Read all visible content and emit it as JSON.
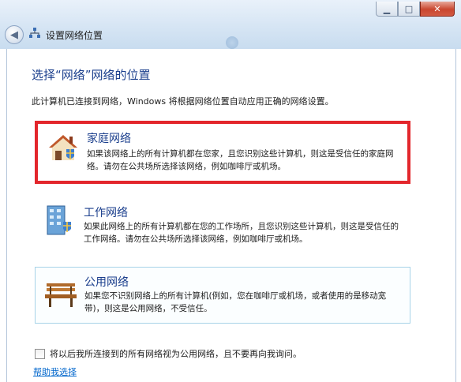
{
  "window": {
    "title": "设置网络位置",
    "caption_buttons": [
      "minimize",
      "maximize",
      "close"
    ]
  },
  "main": {
    "heading": "选择“网络”网络的位置",
    "description": "此计算机已连接到网络，Windows 将根据网络位置自动应用正确的网络设置。",
    "options": [
      {
        "title": "家庭网络",
        "description": "如果该网络上的所有计算机都在您家，且您识别这些计算机，则这是受信任的家庭网络。请勿在公共场所选择该网络，例如咖啡厅或机场。",
        "icon": "house-icon",
        "highlighted": true
      },
      {
        "title": "工作网络",
        "description": "如果此网络上的所有计算机都在您的工作场所，且您识别这些计算机，则这是受信任的工作网络。请勿在公共场所选择该网络，例如咖啡厅或机场。",
        "icon": "office-building-icon",
        "highlighted": false
      },
      {
        "title": "公用网络",
        "description": "如果您不识别网络上的所有计算机(例如，您在咖啡厅或机场，或者使用的是移动宽带)，则这是公用网络，不受信任。",
        "icon": "park-bench-icon",
        "highlighted": false
      }
    ],
    "checkbox_label": "将以后我所连接到的所有网络视为公用网络，且不要再向我询问。",
    "checkbox_checked": false,
    "help_link": "帮助我选择"
  },
  "colors": {
    "accent_text": "#1a3e8c",
    "highlight_border": "#e3262c",
    "link": "#0066cc"
  }
}
